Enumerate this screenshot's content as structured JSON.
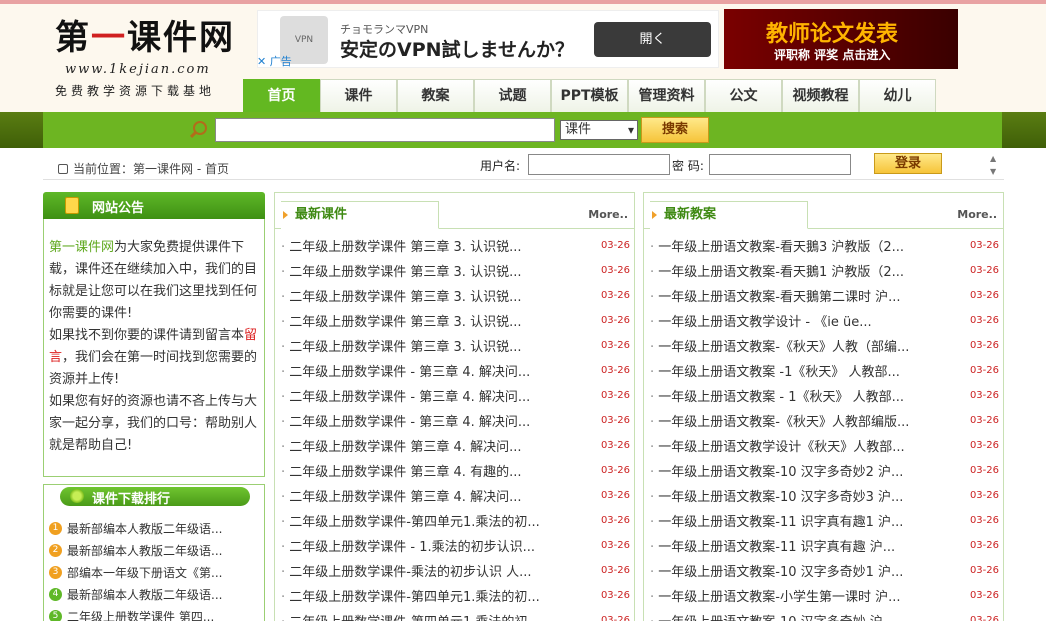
{
  "header": {
    "logo_title_1": "第",
    "logo_title_2": "一",
    "logo_title_3": "课件网",
    "logo_url": "www.1kejian.com",
    "slogan": "免费教学资源下载基地"
  },
  "ad_left": {
    "logo_text": "チョモランマVPN",
    "brand": "チョモランマVPN",
    "headline": "安定のVPN試しませんか？",
    "button": "開く",
    "tag": "✕ 广告"
  },
  "ad_right": {
    "title": "教师论文发表",
    "subtitle": "评职称 评奖 点击进入"
  },
  "nav": [
    "首页",
    "课件",
    "教案",
    "试题",
    "PPT模板",
    "管理资料",
    "公文",
    "视频教程",
    "幼儿"
  ],
  "search": {
    "placeholder": "",
    "select_value": "课件",
    "button": "搜索"
  },
  "location": {
    "text": "当前位置：第一课件网 - 首页"
  },
  "login": {
    "username_label": "用户名:",
    "password_label": "密 码:",
    "button": "登录"
  },
  "notice": {
    "title": "网站公告",
    "p1_green": "第一课件网",
    "p1_rest": "为大家免费提供课件下载，课件还在继续加入中，我们的目标就是让您可以在我们这里找到任何你需要的课件!",
    "p2_a": "如果找不到你要的课件请到留言本",
    "p2_red": "留言",
    "p2_b": "，我们会在第一时间找到您需要的资源并上传!",
    "p3": "如果您有好的资源也请不吝上传与大家一起分享，我们的口号：帮助别人就是帮助自己!"
  },
  "ranking": {
    "title": "课件下载排行",
    "items": [
      {
        "num": "1",
        "text": "最新部编本人教版二年级语..."
      },
      {
        "num": "2",
        "text": "最新部编本人教版二年级语..."
      },
      {
        "num": "3",
        "text": "部编本一年级下册语文《第..."
      },
      {
        "num": "4",
        "text": "最新部编本人教版二年级语..."
      },
      {
        "num": "5",
        "text": "二年级上册数学课件 第四..."
      }
    ],
    "colors": [
      "#f0a020",
      "#f0a020",
      "#f0a020",
      "#5fb828",
      "#5fb828"
    ]
  },
  "latest_courseware": {
    "title": "最新课件",
    "more": "More..",
    "items": [
      {
        "title": "二年级上册数学课件 第三章 3. 认识锐...",
        "date": "03-26"
      },
      {
        "title": "二年级上册数学课件 第三章 3. 认识锐...",
        "date": "03-26"
      },
      {
        "title": "二年级上册数学课件 第三章 3. 认识锐...",
        "date": "03-26"
      },
      {
        "title": "二年级上册数学课件 第三章 3. 认识锐...",
        "date": "03-26"
      },
      {
        "title": "二年级上册数学课件 第三章 3. 认识锐...",
        "date": "03-26"
      },
      {
        "title": "二年级上册数学课件 - 第三章 4. 解决问...",
        "date": "03-26"
      },
      {
        "title": "二年级上册数学课件 - 第三章 4. 解决问...",
        "date": "03-26"
      },
      {
        "title": "二年级上册数学课件 - 第三章 4. 解决问...",
        "date": "03-26"
      },
      {
        "title": "二年级上册数学课件 第三章 4. 解决问...",
        "date": "03-26"
      },
      {
        "title": "二年级上册数学课件 第三章 4. 有趣的...",
        "date": "03-26"
      },
      {
        "title": "二年级上册数学课件 第三章 4. 解决问...",
        "date": "03-26"
      },
      {
        "title": "二年级上册数学课件-第四单元1.乘法的初...",
        "date": "03-26"
      },
      {
        "title": "二年级上册数学课件 - 1.乘法的初步认识...",
        "date": "03-26"
      },
      {
        "title": "二年级上册数学课件-乘法的初步认识 人...",
        "date": "03-26"
      },
      {
        "title": "二年级上册数学课件-第四单元1.乘法的初...",
        "date": "03-26"
      },
      {
        "title": "二年级上册数学课件-第四单元1.乘法的初...",
        "date": "03-26"
      }
    ]
  },
  "latest_lessons": {
    "title": "最新教案",
    "more": "More..",
    "items": [
      {
        "title": "一年级上册语文教案-看天鵝3 沪教版（2...",
        "date": "03-26"
      },
      {
        "title": "一年级上册语文教案-看天鵝1 沪教版（2...",
        "date": "03-26"
      },
      {
        "title": "一年级上册语文教案-看天鵝第二课时 沪...",
        "date": "03-26"
      },
      {
        "title": "一年级上册语文教学设计 - 《ie üe...",
        "date": "03-26"
      },
      {
        "title": "一年级上册语文教案-《秋天》人教（部编...",
        "date": "03-26"
      },
      {
        "title": "一年级上册语文教案 -1《秋天》 人教部...",
        "date": "03-26"
      },
      {
        "title": "一年级上册语文教案 - 1《秋天》 人教部...",
        "date": "03-26"
      },
      {
        "title": "一年级上册语文教案-《秋天》人教部编版...",
        "date": "03-26"
      },
      {
        "title": "一年级上册语文教学设计《秋天》人教部...",
        "date": "03-26"
      },
      {
        "title": "一年级上册语文教案-10 汉字多奇妙2 沪...",
        "date": "03-26"
      },
      {
        "title": "一年级上册语文教案-10 汉字多奇妙3 沪...",
        "date": "03-26"
      },
      {
        "title": "一年级上册语文教案-11 识字真有趣1 沪...",
        "date": "03-26"
      },
      {
        "title": "一年级上册语文教案-11 识字真有趣 沪...",
        "date": "03-26"
      },
      {
        "title": "一年级上册语文教案-10 汉字多奇妙1 沪...",
        "date": "03-26"
      },
      {
        "title": "一年级上册语文教案-小学生第一课时 沪...",
        "date": "03-26"
      },
      {
        "title": "一年级上册语文教案-10 汉字多奇妙 沪...",
        "date": "03-26"
      }
    ]
  },
  "colors": {
    "brand_green": "#63b821",
    "dark_green_band": "#4a6c0c",
    "date_red": "#cc2222",
    "button_gold": "#f6c43a"
  }
}
